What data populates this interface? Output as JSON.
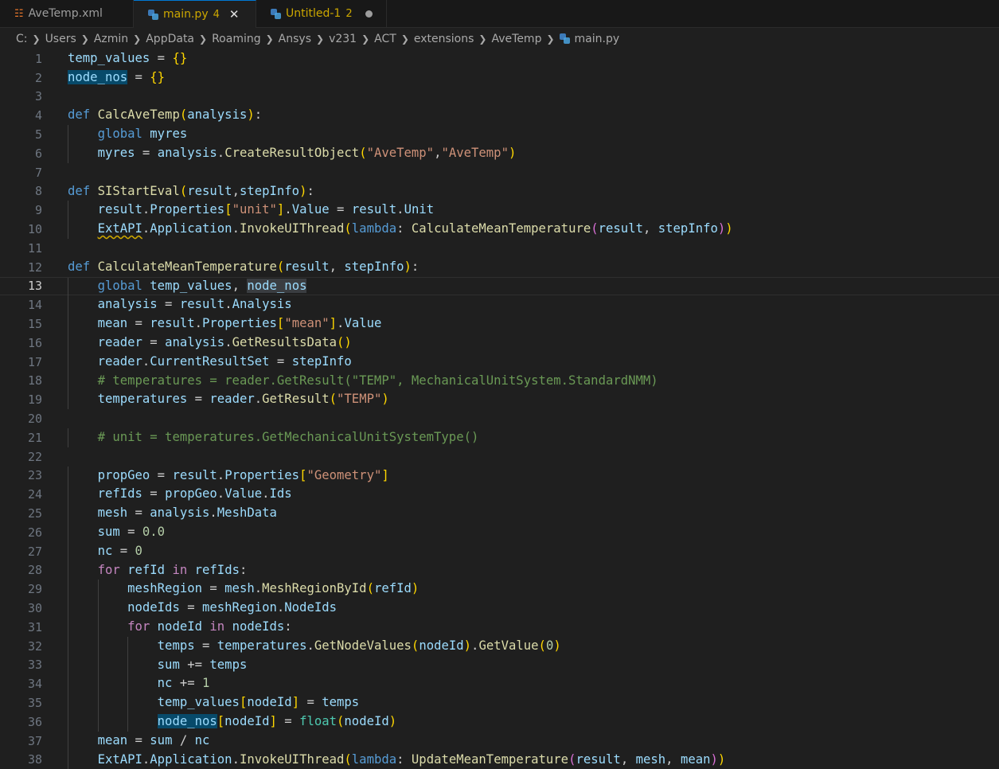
{
  "tabs": [
    {
      "label": "AveTemp.xml",
      "icon": "rss-icon"
    },
    {
      "label": "main.py",
      "icon": "python-icon",
      "badge": "4",
      "active": true
    },
    {
      "label": "Untitled-1",
      "icon": "python-icon",
      "badge": "2",
      "dirty": true
    }
  ],
  "breadcrumb": [
    "C:",
    "Users",
    "Azmin",
    "AppData",
    "Roaming",
    "Ansys",
    "v231",
    "ACT",
    "extensions",
    "AveTemp",
    "main.py"
  ],
  "editor": {
    "current_line": 13,
    "lines": [
      "temp_values = {}",
      "node_nos = {}",
      "",
      "def CalcAveTemp(analysis):",
      "    global myres",
      "    myres = analysis.CreateResultObject(\"AveTemp\",\"AveTemp\")",
      "",
      "def SIStartEval(result,stepInfo):",
      "    result.Properties[\"unit\"].Value = result.Unit",
      "    ExtAPI.Application.InvokeUIThread(lambda: CalculateMeanTemperature(result, stepInfo))",
      "",
      "def CalculateMeanTemperature(result, stepInfo):",
      "    global temp_values, node_nos",
      "    analysis = result.Analysis",
      "    mean = result.Properties[\"mean\"].Value",
      "    reader = analysis.GetResultsData()",
      "    reader.CurrentResultSet = stepInfo",
      "    # temperatures = reader.GetResult(\"TEMP\", MechanicalUnitSystem.StandardNMM)",
      "    temperatures = reader.GetResult(\"TEMP\")",
      "",
      "    # unit = temperatures.GetMechanicalUnitSystemType()",
      "",
      "    propGeo = result.Properties[\"Geometry\"]",
      "    refIds = propGeo.Value.Ids",
      "    mesh = analysis.MeshData",
      "    sum = 0.0",
      "    nc = 0",
      "    for refId in refIds:",
      "        meshRegion = mesh.MeshRegionById(refId)",
      "        nodeIds = meshRegion.NodeIds",
      "        for nodeId in nodeIds:",
      "            temps = temperatures.GetNodeValues(nodeId).GetValue(0)",
      "            sum += temps",
      "            nc += 1",
      "            temp_values[nodeId] = temps",
      "            node_nos[nodeId] = float(nodeId)",
      "    mean = sum / nc",
      "    ExtAPI.Application.InvokeUIThread(lambda: UpdateMeanTemperature(result, mesh, mean))"
    ]
  },
  "colors": {
    "background": "#1f1f1f",
    "keyword": "#569cd6",
    "control": "#c586c0",
    "function": "#dcdcaa",
    "variable": "#9cdcfe",
    "string": "#ce9178",
    "number": "#b5cea8",
    "comment": "#6a9955",
    "accent": "#0078d4"
  }
}
